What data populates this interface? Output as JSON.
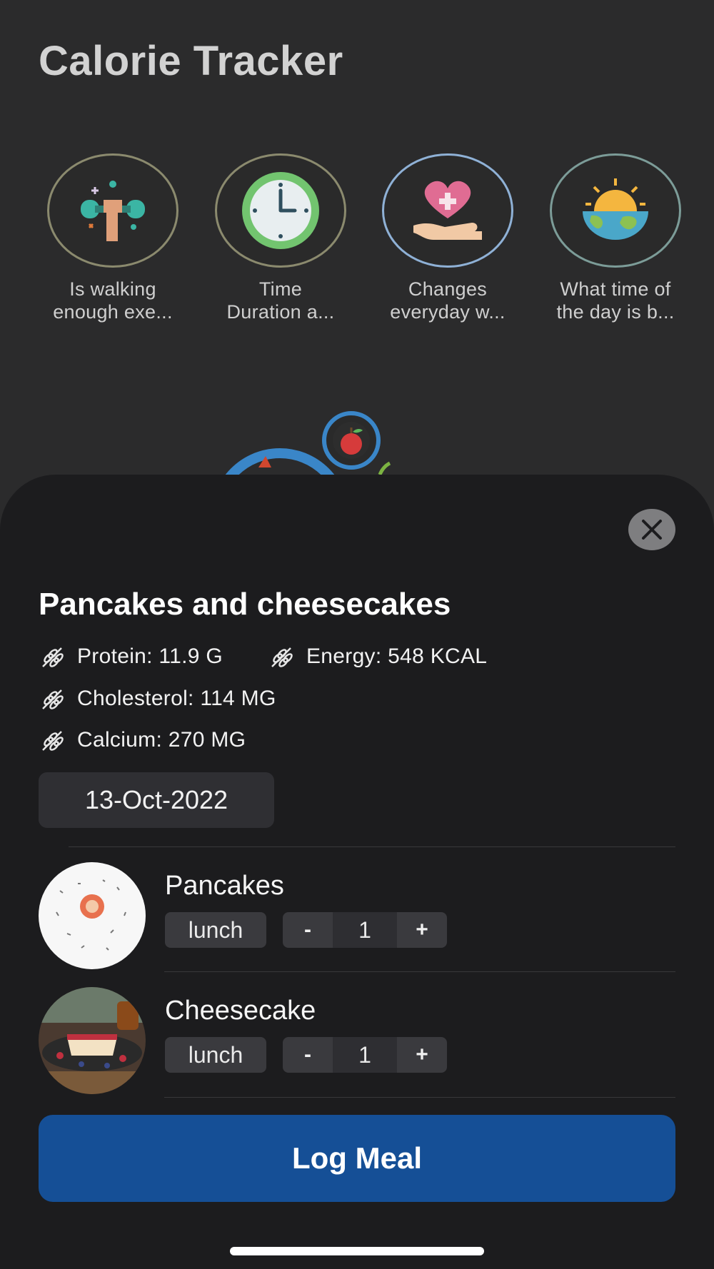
{
  "app": {
    "title": "Calorie Tracker"
  },
  "stories": [
    {
      "label_line1": "Is walking",
      "label_line2": "enough exe...",
      "icon": "dumbbell-hand-icon"
    },
    {
      "label_line1": "Time",
      "label_line2": "Duration a...",
      "icon": "clock-icon"
    },
    {
      "label_line1": "Changes",
      "label_line2": "everyday w...",
      "icon": "heart-hand-icon"
    },
    {
      "label_line1": "What time of",
      "label_line2": "the day is b...",
      "icon": "sunrise-earth-icon"
    }
  ],
  "meal": {
    "title": "Pancakes and cheesecakes",
    "nutrients": {
      "protein": "Protein: 11.9 G",
      "energy": "Energy: 548 KCAL",
      "cholesterol": "Cholesterol: 114 MG",
      "calcium": "Calcium: 270 MG"
    },
    "date": "13-Oct-2022",
    "items": [
      {
        "name": "Pancakes",
        "meal_type": "lunch",
        "quantity": "1",
        "minus": "-",
        "plus": "+"
      },
      {
        "name": "Cheesecake",
        "meal_type": "lunch",
        "quantity": "1",
        "minus": "-",
        "plus": "+"
      }
    ],
    "log_button": "Log Meal"
  },
  "colors": {
    "accent": "#154f96",
    "sheet": "#1c1c1e",
    "background": "#2b2b2c"
  }
}
